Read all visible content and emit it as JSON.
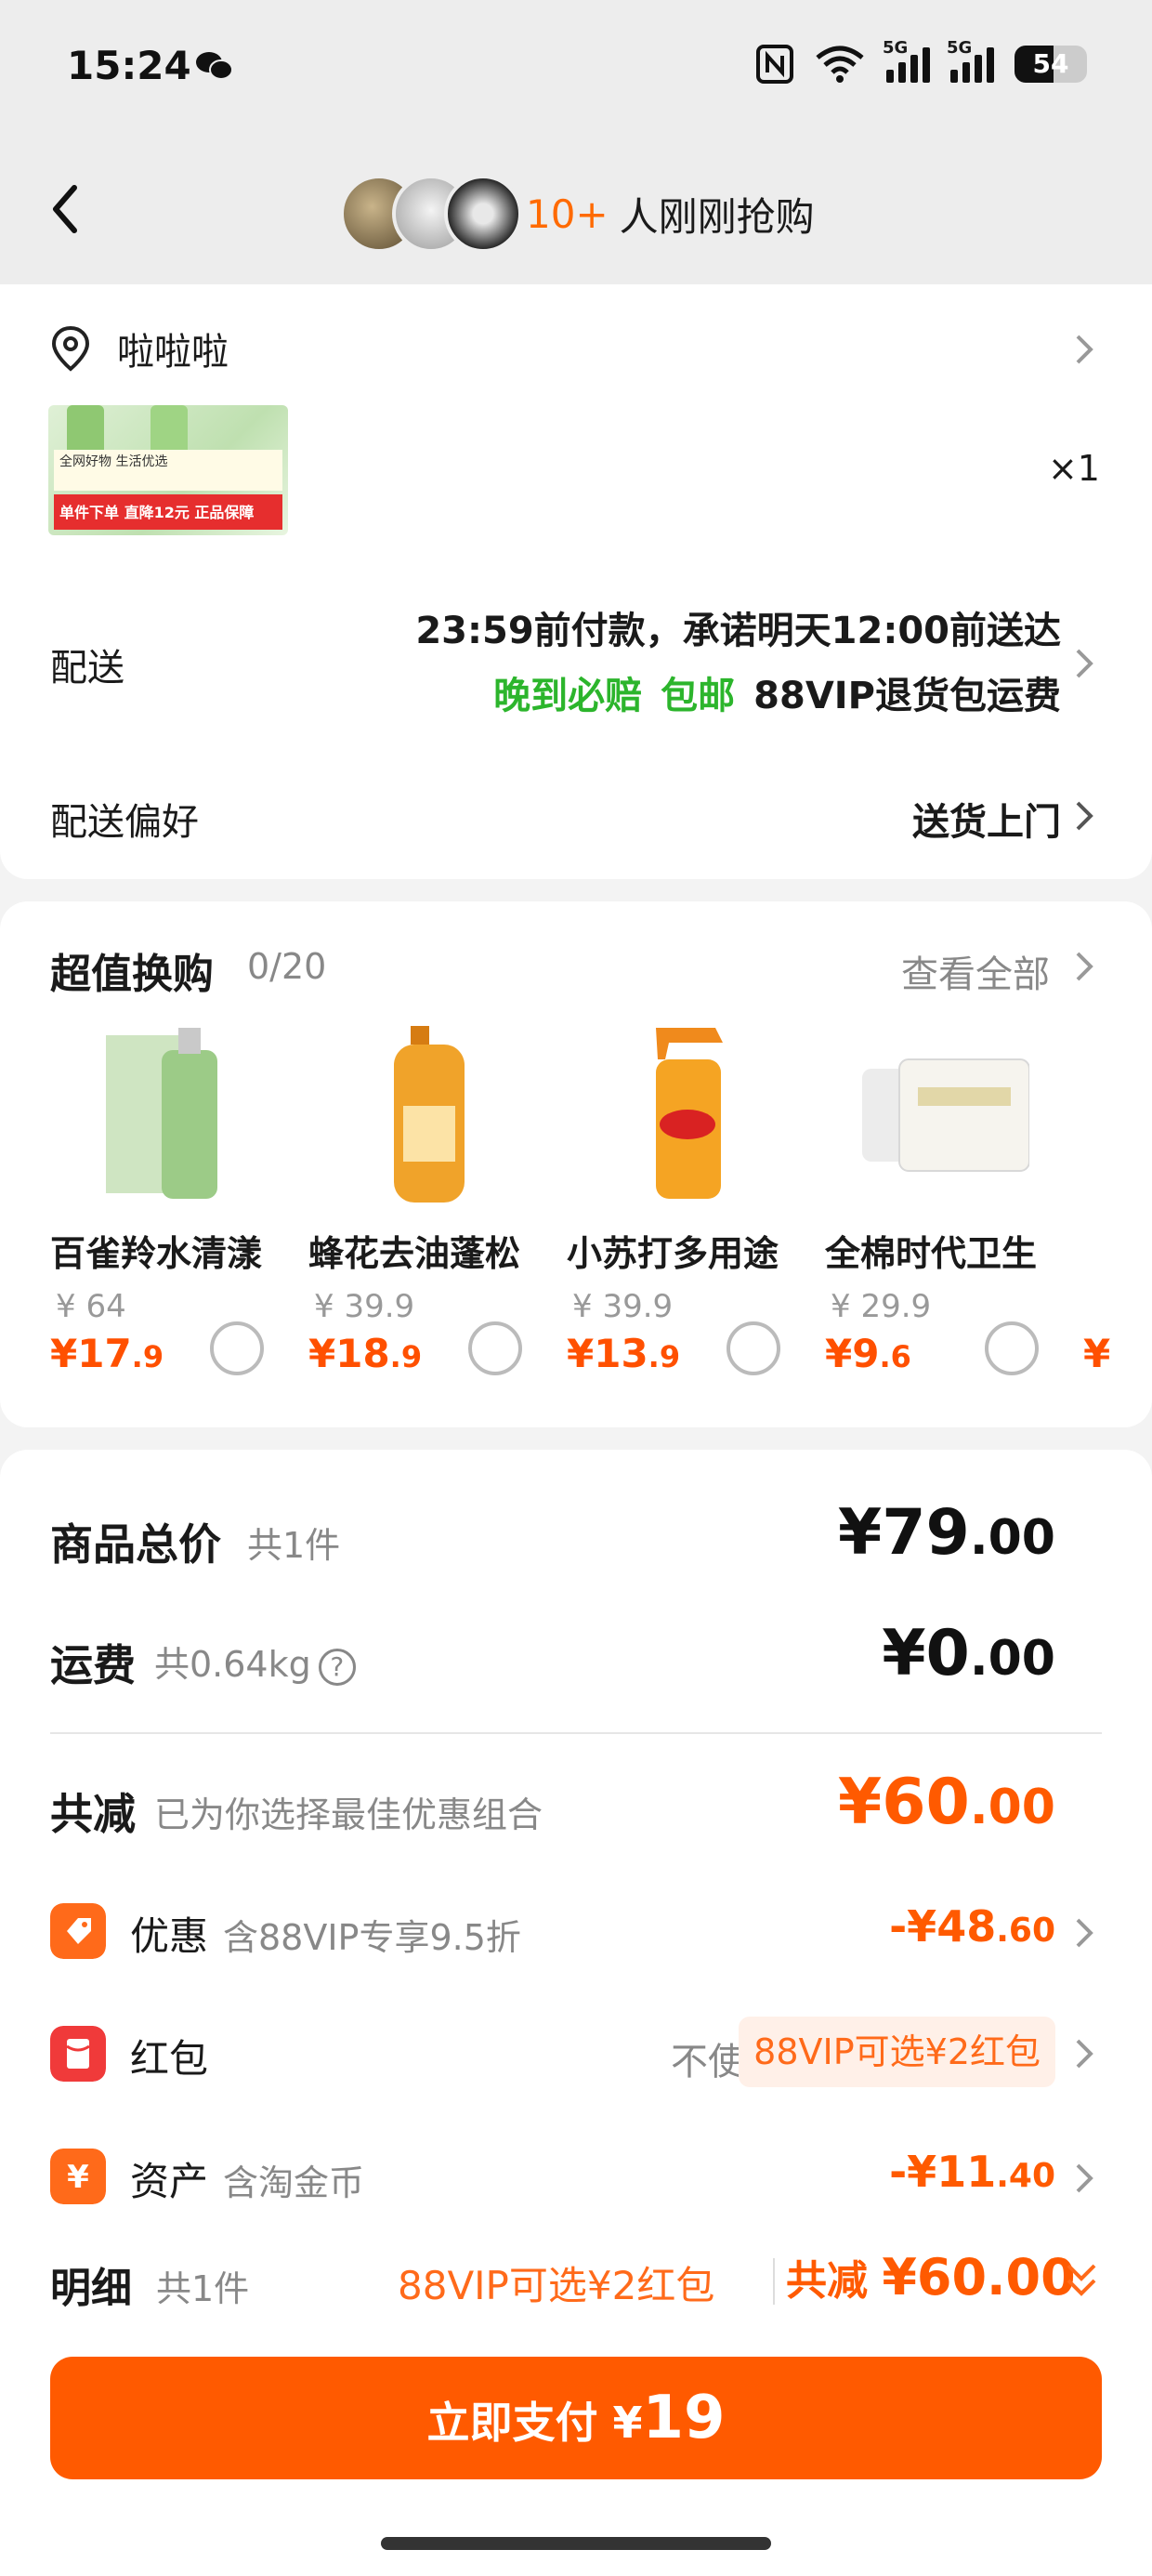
{
  "status_bar": {
    "time": "15:24",
    "battery": "54",
    "network": "5G"
  },
  "header": {
    "buyers_count": "10+",
    "buyers_text": "人刚刚抢购"
  },
  "address": {
    "name": "啦啦啦"
  },
  "order_item": {
    "quantity": "×1"
  },
  "delivery": {
    "label": "配送",
    "promise": "23:59前付款，承诺明天12:00前送达",
    "tag_late": "晚到必赔",
    "tag_free": "包邮",
    "tag_vip": "88VIP退货包运费"
  },
  "delivery_pref": {
    "label": "配送偏好",
    "value": "送货上门"
  },
  "swap": {
    "title": "超值换购",
    "count": "0/20",
    "view_all": "查看全部",
    "items": [
      {
        "name": "百雀羚水清漾",
        "orig": "¥ 64",
        "price_int": "¥17",
        "price_dec": ".9"
      },
      {
        "name": "蜂花去油蓬松",
        "orig": "¥ 39.9",
        "price_int": "¥18",
        "price_dec": ".9"
      },
      {
        "name": "小苏打多用途",
        "orig": "¥ 39.9",
        "price_int": "¥13",
        "price_dec": ".9"
      },
      {
        "name": "全棉时代卫生",
        "orig": "¥ 29.9",
        "price_int": "¥9",
        "price_dec": ".6"
      }
    ]
  },
  "summary": {
    "goods_label": "商品总价",
    "goods_sub": "共1件",
    "goods_int": "¥79",
    "goods_dec": ".00",
    "ship_label": "运费",
    "ship_sub": "共0.64kg",
    "ship_int": "¥0",
    "ship_dec": ".00",
    "reduce_label": "共减",
    "reduce_sub": "已为你选择最佳优惠组合",
    "reduce_int": "¥60",
    "reduce_dec": ".00"
  },
  "discounts": {
    "promo_label": "优惠",
    "promo_sub": "含88VIP专享9.5折",
    "promo_int": "-¥48",
    "promo_dec": ".60",
    "redpacket_label": "红包",
    "redpacket_status": "不使用",
    "redpacket_pill": "88VIP可选¥2红包",
    "asset_label": "资产",
    "asset_sub": "含淘金币",
    "asset_int": "-¥11",
    "asset_dec": ".40"
  },
  "detail": {
    "label": "明细",
    "sub": "共1件",
    "pill": "88VIP可选¥2红包",
    "total_label": "共减",
    "total_amount": "¥60.00"
  },
  "pay": {
    "label": "立即支付",
    "currency": "¥",
    "amount": "19"
  },
  "colors": {
    "accent": "#ff5a00",
    "green": "#2cb52c"
  }
}
